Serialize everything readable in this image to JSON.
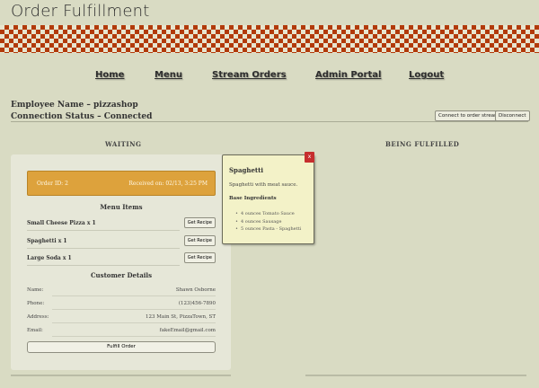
{
  "header": {
    "title": "Order Fulfillment"
  },
  "nav": [
    "Home",
    "Menu",
    "Stream Orders",
    "Admin Portal",
    "Logout"
  ],
  "employee": {
    "name_line": "Employee Name – pizzashop",
    "status_line": "Connection Status – Connected"
  },
  "buttons": {
    "connect": "Connect to order stream",
    "disconnect": "Disconnect"
  },
  "columns": {
    "waiting": "WAITING",
    "fulfilled": "BEING FULFILLED"
  },
  "order": {
    "id_label": "Order ID: 2",
    "received": "Received on: 02/13, 3:25 PM",
    "menu_items_title": "Menu Items",
    "items": [
      {
        "name": "Small Cheese Pizza x 1",
        "button": "Get Recipe"
      },
      {
        "name": "Spaghetti x 1",
        "button": "Get Recipe"
      },
      {
        "name": "Large Soda x 1",
        "button": "Get Recipe"
      }
    ],
    "customer_title": "Customer Details",
    "customer": [
      {
        "label": "Name:",
        "value": "Shawn Osborne"
      },
      {
        "label": "Phone:",
        "value": "(123)456-7890"
      },
      {
        "label": "Address:",
        "value": "123 Main St, PizzaTown, ST"
      },
      {
        "label": "Email:",
        "value": "fakeEmail@gmail.com"
      }
    ],
    "fulfill_button": "Fulfill Order"
  },
  "popup": {
    "close": "x",
    "title": "Spaghetti",
    "description": "Spaghetti with meat sauce.",
    "subtitle": "Base Ingredients",
    "ingredients": [
      "4 ounces Tomato Sauce",
      "4 ounces Sausage",
      "5 ounces Pasta - Spaghetti"
    ]
  },
  "colors": {
    "checker": "#b23a0a",
    "order_bar": "#dda23c",
    "close": "#c62e2e",
    "popup_bg": "#f3f2c8"
  }
}
